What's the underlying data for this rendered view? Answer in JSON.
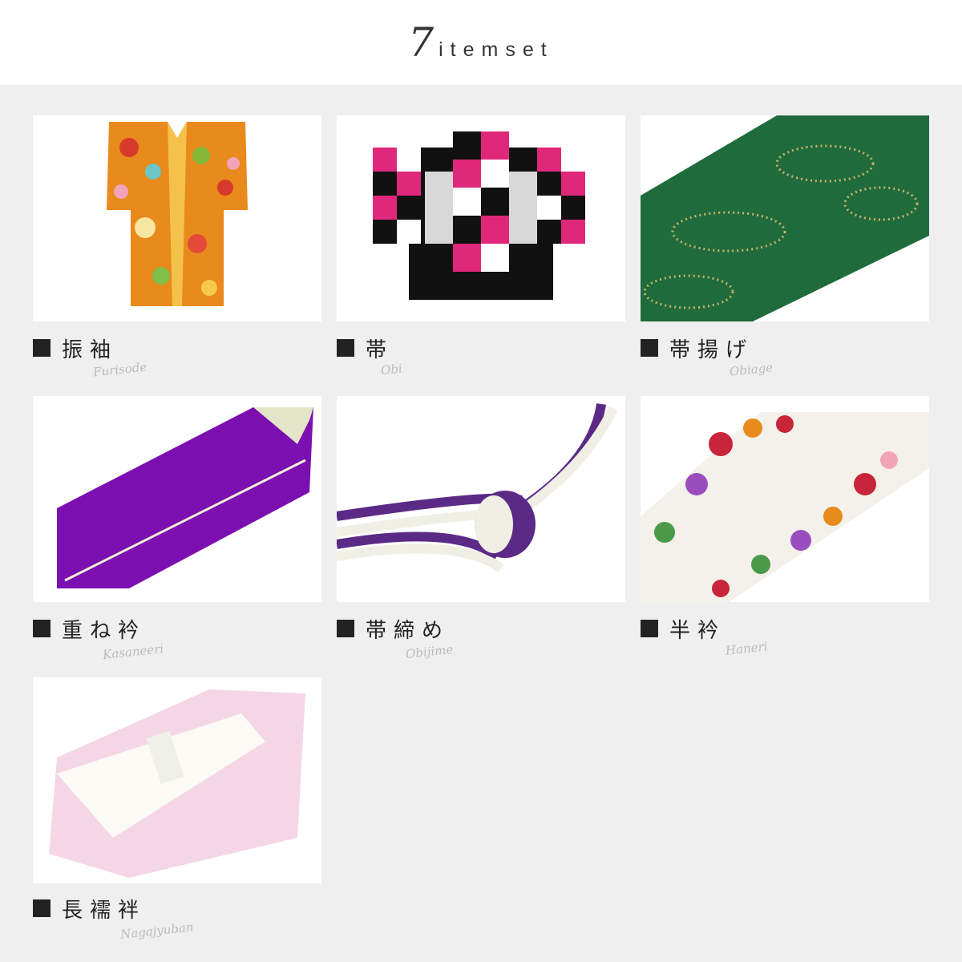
{
  "header": {
    "number": "7",
    "text": "itemset"
  },
  "items": [
    {
      "label": "振袖",
      "romaji": "Furisode"
    },
    {
      "label": "帯",
      "romaji": "Obi"
    },
    {
      "label": "帯揚げ",
      "romaji": "Obiage"
    },
    {
      "label": "重ね衿",
      "romaji": "Kasaneeri"
    },
    {
      "label": "帯締め",
      "romaji": "Obijime"
    },
    {
      "label": "半衿",
      "romaji": "Haneri"
    },
    {
      "label": "長襦袢",
      "romaji": "Nagajyuban"
    }
  ],
  "colors": {
    "furisode": "#e98a1c",
    "obi_pink": "#e0287a",
    "obiage_green": "#1f6b3c",
    "kasaneeri_purple": "#7b0fb0",
    "obijime_purple": "#5b2a86",
    "haneri_red": "#c8243a",
    "nagajyuban_pink": "#f5d6e6"
  }
}
